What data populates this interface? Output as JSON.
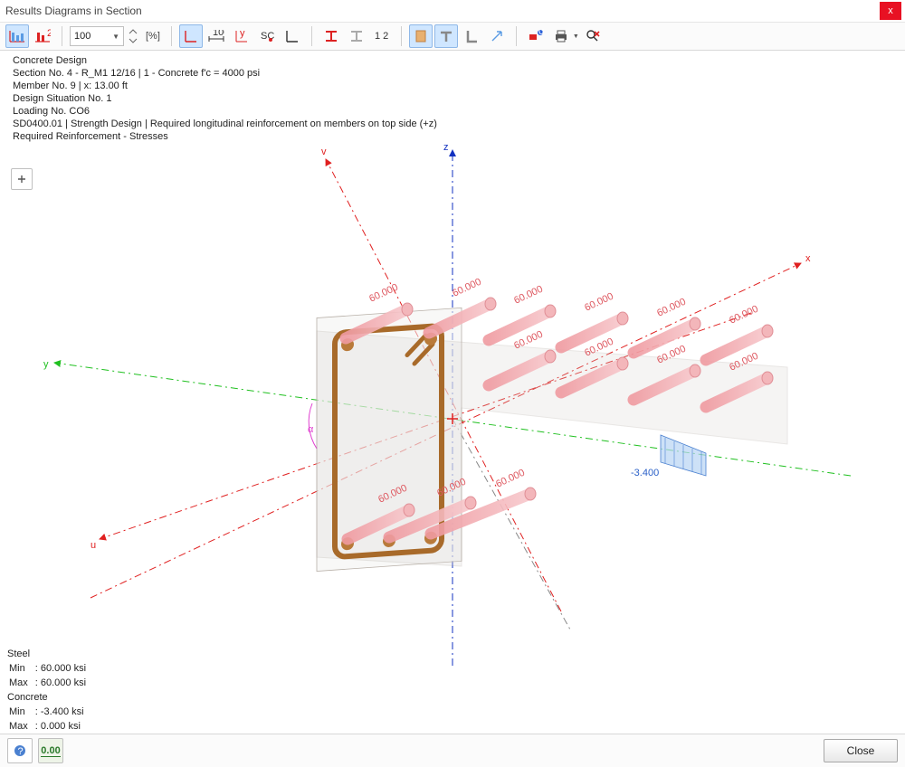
{
  "window": {
    "title": "Results Diagrams in Section",
    "close": "x"
  },
  "toolbar": {
    "zoom": "100",
    "unit": "[%]"
  },
  "info": {
    "l1": "Concrete Design",
    "l2": "Section No. 4 - R_M1 12/16 | 1 - Concrete f'c = 4000 psi",
    "l3": "Member No. 9 | x: 13.00 ft",
    "l4": "Design Situation No. 1",
    "l5": "Loading No. CO6",
    "l6": "SD0400.01 | Strength Design | Required longitudinal reinforcement on members on top side (+z)",
    "l7": "Required Reinforcement - Stresses"
  },
  "axes": {
    "x": "x",
    "y": "y",
    "z": "z",
    "u": "u",
    "v": "v",
    "alpha": "α"
  },
  "bar_label": "60.000",
  "concrete_value": "-3.400",
  "legend": {
    "steel_h": "Steel",
    "min_l": "Min",
    "max_l": "Max",
    "steel_min": ": 60.000 ksi",
    "steel_max": ": 60.000 ksi",
    "conc_h": "Concrete",
    "conc_min": ": -3.400 ksi",
    "conc_max": ":   0.000 ksi"
  },
  "footer": {
    "close": "Close",
    "val": "0.00"
  }
}
